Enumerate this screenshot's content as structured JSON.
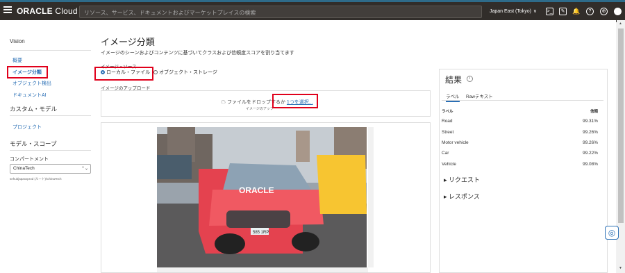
{
  "topbar": {
    "brand_name": "ORACLE",
    "brand_product": "Cloud",
    "search_placeholder": "リソース、サービス、ドキュメントおよびマーケットプレイスの検索",
    "region": "Japan East (Tokyo)",
    "icons": [
      "cloud-shell-icon",
      "edit-icon",
      "bell-icon",
      "help-icon",
      "globe-icon",
      "user-icon"
    ]
  },
  "sidebar": {
    "title": "Vision",
    "links": [
      {
        "label": "概要",
        "active": false
      },
      {
        "label": "イメージ分類",
        "active": true
      },
      {
        "label": "オブジェクト検出",
        "active": false
      },
      {
        "label": "ドキュメントAI",
        "active": false
      }
    ],
    "custom_models_heading": "カスタム・モデル",
    "projects_label": "プロジェクト",
    "scope_heading": "モデル・スコープ",
    "compartment_label": "コンパートメント",
    "compartment_value": "ChinaTech",
    "compartment_path": "sehubjapaxxprod (ルート)/ChinaTech"
  },
  "main": {
    "title": "イメージ分類",
    "description": "イメージのシーンおよびコンテンツに基づいてクラスおよび信頼度スコアを割り当てます",
    "source_label": "イメージ・ソース",
    "source_options": [
      {
        "label": "ローカル・ファイル",
        "selected": true
      },
      {
        "label": "オブジェクト・ストレージ",
        "selected": false
      }
    ],
    "upload_label": "イメージのアップロード",
    "upload_text": "ファイルをドロップするか",
    "upload_link": "1つを選択...",
    "upload_sub": "イメージのアップ"
  },
  "results": {
    "title": "結果",
    "tabs": [
      "ラベル",
      "Rawテキスト"
    ],
    "col_label": "ラベル",
    "col_confidence": "信頼",
    "rows": [
      {
        "label": "Road",
        "value": "99.31%"
      },
      {
        "label": "Street",
        "value": "99.26%"
      },
      {
        "label": "Motor vehicle",
        "value": "99.26%"
      },
      {
        "label": "Car",
        "value": "99.22%"
      },
      {
        "label": "Vehicle",
        "value": "99.08%"
      }
    ],
    "request_label": "リクエスト",
    "response_label": "レスポンス"
  },
  "photo": {
    "car_brand": "ORACLE",
    "plate": "585 1RP"
  },
  "colors": {
    "topbar": "#312d2a",
    "link": "#2a6fb5",
    "highlight": "#e0001b"
  }
}
